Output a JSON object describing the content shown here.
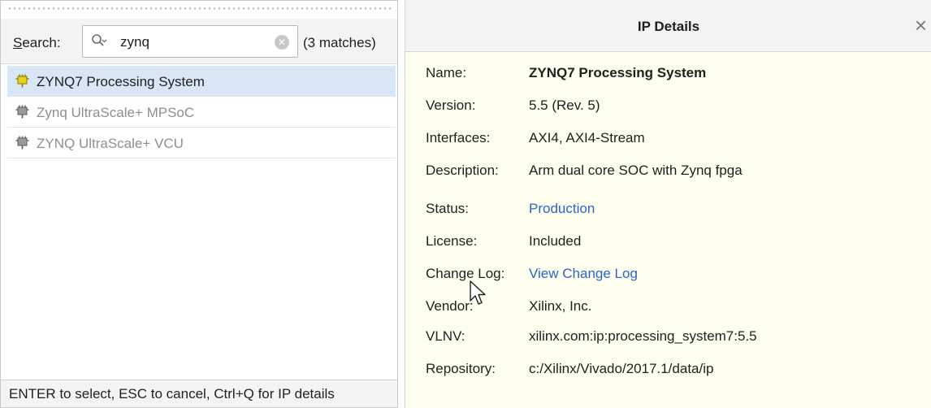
{
  "search": {
    "label_prefix": "S",
    "label_rest": "earch:",
    "value": "zynq",
    "matches": "(3 matches)"
  },
  "ip_list": [
    {
      "label": "ZYNQ7 Processing System",
      "selected": true
    },
    {
      "label": "Zynq UltraScale+ MPSoC",
      "selected": false
    },
    {
      "label": "ZYNQ UltraScale+ VCU",
      "selected": false
    }
  ],
  "hint": "ENTER to select, ESC to cancel, Ctrl+Q for IP details",
  "details": {
    "title": "IP Details",
    "close_glyph": "×",
    "properties": [
      {
        "key": "Name:",
        "value": "ZYNQ7 Processing System",
        "style": "bold"
      },
      {
        "key": "Version:",
        "value": "5.5 (Rev. 5)",
        "style": "normal"
      },
      {
        "key": "Interfaces:",
        "value": "AXI4, AXI4-Stream",
        "style": "normal"
      },
      {
        "key": "Description:",
        "value": "Arm dual core SOC with Zynq fpga",
        "style": "normal"
      },
      {
        "key": "Status:",
        "value": "Production",
        "style": "link"
      },
      {
        "key": "License:",
        "value": "Included",
        "style": "normal"
      },
      {
        "key": "Change Log:",
        "value": "View Change Log",
        "style": "link"
      },
      {
        "key": "Vendor:",
        "value": "Xilinx, Inc.",
        "style": "normal"
      },
      {
        "key": "VLNV:",
        "value": "xilinx.com:ip:processing_system7:5.5",
        "style": "normal"
      },
      {
        "key": "Repository:",
        "value": "c:/Xilinx/Vivado/2017.1/data/ip",
        "style": "normal"
      }
    ]
  },
  "colors": {
    "selection": "#d8e6f6",
    "details_bg": "#fffff0",
    "link": "#2a64c8",
    "chip_active": "#e8d21a",
    "chip_inactive": "#7a7a7a"
  },
  "icons": {
    "search": "search-icon",
    "clear": "clear-search-icon",
    "ip_chip": "ip-core-icon",
    "close": "close-icon",
    "cursor": "mouse-pointer-icon"
  }
}
